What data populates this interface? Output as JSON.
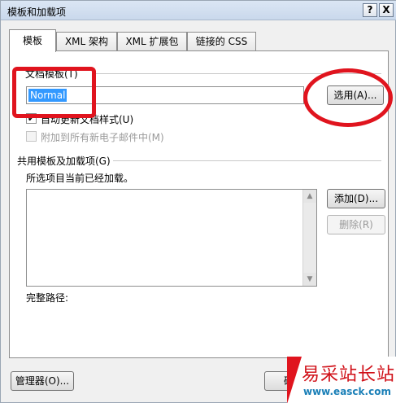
{
  "window": {
    "title": "模板和加载项",
    "help_label": "?",
    "close_label": "X"
  },
  "tabs": [
    {
      "label": "模板",
      "active": true
    },
    {
      "label": "XML 架构",
      "active": false
    },
    {
      "label": "XML 扩展包",
      "active": false
    },
    {
      "label": "链接的 CSS",
      "active": false
    }
  ],
  "document_template": {
    "group_label": "文档模板(T)",
    "value": "Normal",
    "attach_button": "选用(A)...",
    "auto_update": {
      "label": "自动更新文档样式(U)",
      "checked": true,
      "check_glyph": "✔"
    },
    "attach_to_new_email": {
      "label": "附加到所有新电子邮件中(M)",
      "checked": false,
      "disabled": true
    }
  },
  "global_templates": {
    "group_label": "共用模板及加载项(G)",
    "description": "所选项目当前已经加载。",
    "items": [],
    "add_button": "添加(D)...",
    "remove_button": "删除(R)",
    "full_path_label": "完整路径:"
  },
  "footer": {
    "organizer_button": "管理器(O)...",
    "ok_button": "确定"
  },
  "watermark": {
    "text": "易采站长站",
    "url": "www.easck.com"
  },
  "colors": {
    "highlight": "#3399ff",
    "annotation": "#e0141e"
  }
}
